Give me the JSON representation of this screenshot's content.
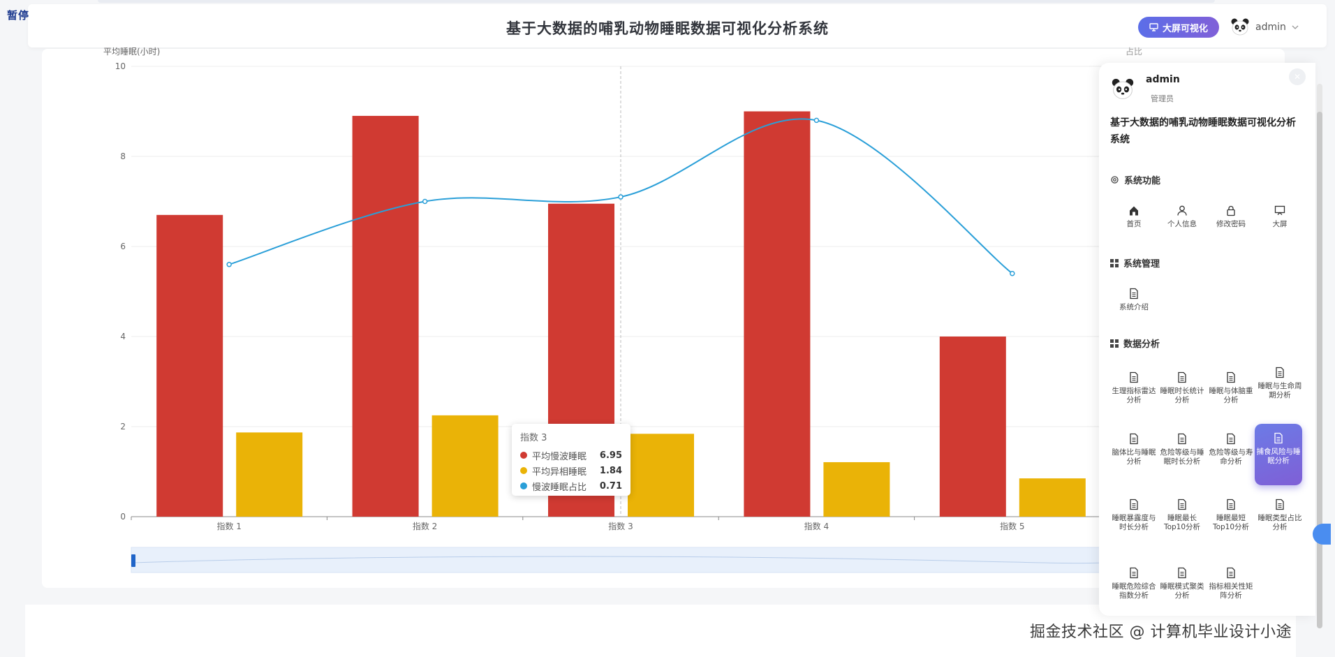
{
  "pause_label": "暂停",
  "header": {
    "title": "基于大数据的哺乳动物睡眠数据可视化分析系统",
    "bigscreen_button": "大屏可视化",
    "user": "admin"
  },
  "chart_data": {
    "type": "bar",
    "ylabel": "平均睡眠(小时)",
    "y2label": "占比",
    "ylim": [
      0,
      10
    ],
    "yticks": [
      "0",
      "2",
      "4",
      "6",
      "8",
      "10"
    ],
    "categories": [
      "指数 1",
      "指数 2",
      "指数 3",
      "指数 4",
      "指数 5"
    ],
    "series": [
      {
        "name": "平均慢波睡眠",
        "type": "bar",
        "color": "#d03a32",
        "values": [
          6.7,
          8.9,
          6.95,
          9.0,
          4.0
        ]
      },
      {
        "name": "平均异相睡眠",
        "type": "bar",
        "color": "#eab307",
        "values": [
          1.87,
          2.25,
          1.84,
          1.21,
          0.85
        ]
      },
      {
        "name": "慢波睡眠占比",
        "type": "line",
        "color": "#2a9fd8",
        "values": [
          5.6,
          7.0,
          7.1,
          8.8,
          5.4
        ]
      }
    ],
    "tooltip": {
      "title": "指数 3",
      "rows": [
        {
          "name": "平均慢波睡眠",
          "value": "6.95",
          "color": "#d03a32"
        },
        {
          "name": "平均异相睡眠",
          "value": "1.84",
          "color": "#eab307"
        },
        {
          "name": "慢波睡眠占比",
          "value": "0.71",
          "color": "#2a9fd8"
        }
      ]
    }
  },
  "drawer": {
    "user": "admin",
    "role": "管理员",
    "system_title": "基于大数据的哺乳动物睡眠数据可视化分析系统",
    "sections": {
      "functions": {
        "title": "系统功能",
        "items": [
          "首页",
          "个人信息",
          "修改密码",
          "大屏"
        ]
      },
      "management": {
        "title": "系统管理",
        "items": [
          "系统介绍"
        ]
      },
      "analysis": {
        "title": "数据分析",
        "items": [
          "生理指标雷达分析",
          "睡眠时长统计分析",
          "睡眠与体脑重分析",
          "睡眠与生命周期分析",
          "脑体比与睡眠分析",
          "危险等级与睡眠时长分析",
          "危险等级与寿命分析",
          "捕食风险与睡眠分析",
          "睡眠暴露度与时长分析",
          "睡眠最长Top10分析",
          "睡眠最短Top10分析",
          "睡眠类型占比分析",
          "睡眠危险综合指数分析",
          "睡眠模式聚类分析",
          "指标相关性矩阵分析"
        ],
        "active": "捕食风险与睡眠分析"
      }
    }
  },
  "watermark": "掘金技术社区 @ 计算机毕业设计小途"
}
